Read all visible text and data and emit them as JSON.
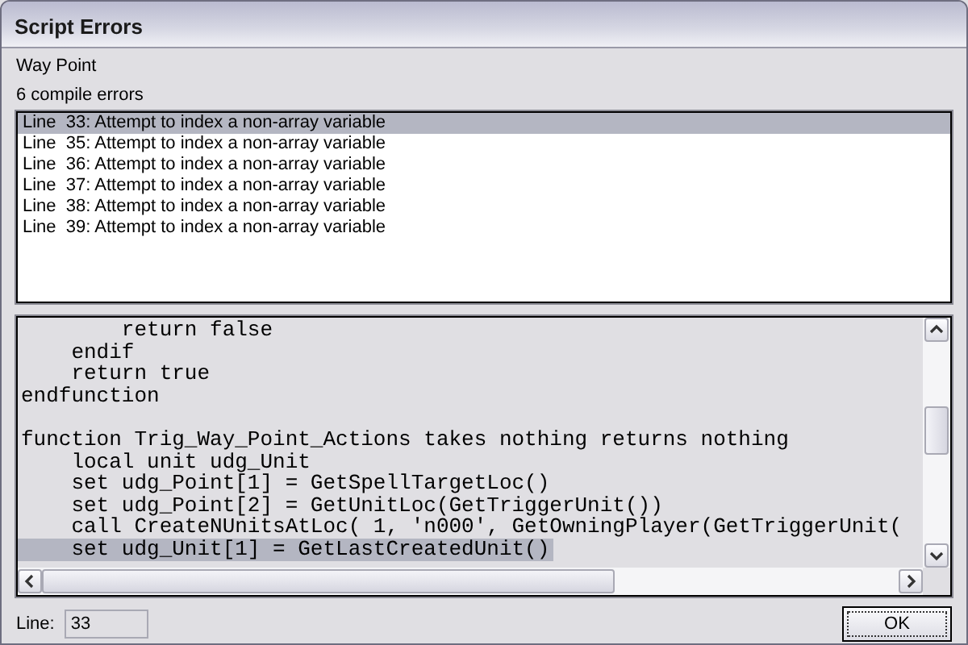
{
  "window": {
    "title": "Script Errors"
  },
  "trigger_name": "Way Point",
  "error_count": "6 compile errors",
  "errors": [
    {
      "text": "Line  33: Attempt to index a non-array variable",
      "selected": true
    },
    {
      "text": "Line  35: Attempt to index a non-array variable",
      "selected": false
    },
    {
      "text": "Line  36: Attempt to index a non-array variable",
      "selected": false
    },
    {
      "text": "Line  37: Attempt to index a non-array variable",
      "selected": false
    },
    {
      "text": "Line  38: Attempt to index a non-array variable",
      "selected": false
    },
    {
      "text": "Line  39: Attempt to index a non-array variable",
      "selected": false
    }
  ],
  "code_blocks": [
    {
      "lines": [
        {
          "text": "        return false",
          "selected": false
        },
        {
          "text": "    endif",
          "selected": false
        },
        {
          "text": "    return true",
          "selected": false
        },
        {
          "text": "endfunction",
          "selected": false
        }
      ]
    },
    {
      "lines": [
        {
          "text": "function Trig_Way_Point_Actions takes nothing returns nothing",
          "selected": false
        },
        {
          "text": "    local unit udg_Unit",
          "selected": false
        },
        {
          "text": "    set udg_Point[1] = GetSpellTargetLoc()",
          "selected": false
        },
        {
          "text": "    set udg_Point[2] = GetUnitLoc(GetTriggerUnit())",
          "selected": false
        },
        {
          "text": "    call CreateNUnitsAtLoc( 1, 'n000', GetOwningPlayer(GetTriggerUnit(",
          "selected": false
        },
        {
          "text": "    set udg_Unit[1] = GetLastCreatedUnit()",
          "selected": true
        }
      ]
    }
  ],
  "line_field": {
    "label": "Line:",
    "value": "33"
  },
  "ok_button": "OK"
}
